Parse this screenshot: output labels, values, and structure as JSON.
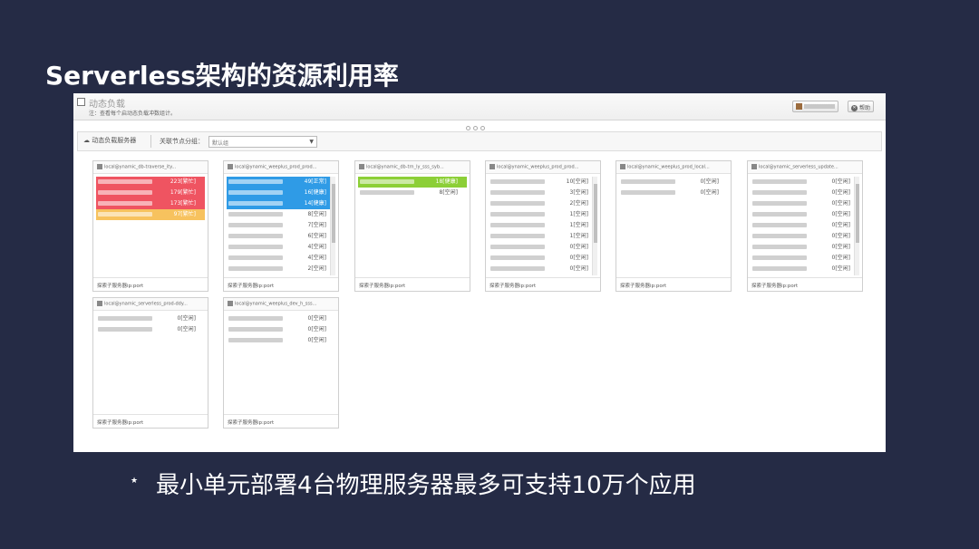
{
  "slide": {
    "title": "Serverless架构的资源利用率",
    "bullet_symbol": "★",
    "bullet_text": "最小单元部署4台物理服务器最多可支持10万个应用"
  },
  "app": {
    "heading": "动态负载",
    "note": "注：查看每个启动态负载冲数组计。",
    "help_label": "帮助",
    "filter_tab": "动态负载服务器",
    "filter_label": "关联节点分组：",
    "filter_value": "默认组"
  },
  "cards": [
    {
      "title": "local@ynamic_db-traverse_ity...",
      "footer": "探索子服务器ip:port",
      "rows": [
        {
          "status": "red",
          "value": "223[繁忙]"
        },
        {
          "status": "red",
          "value": "179[繁忙]"
        },
        {
          "status": "red",
          "value": "173[繁忙]"
        },
        {
          "status": "orange",
          "value": "97[繁忙]"
        }
      ]
    },
    {
      "title": "local@ynamic_weeplus_prod_prod...",
      "footer": "探索子服务器ip:port",
      "scroll": true,
      "rows": [
        {
          "status": "blue",
          "value": "49[正常]"
        },
        {
          "status": "blue",
          "value": "16[健康]"
        },
        {
          "status": "blue",
          "value": "14[健康]"
        },
        {
          "status": "",
          "value": "8[空闲]"
        },
        {
          "status": "",
          "value": "7[空闲]"
        },
        {
          "status": "",
          "value": "6[空闲]"
        },
        {
          "status": "",
          "value": "4[空闲]"
        },
        {
          "status": "",
          "value": "4[空闲]"
        },
        {
          "status": "",
          "value": "2[空闲]"
        }
      ]
    },
    {
      "title": "local@ynamic_db-trn_ly_sss_syb...",
      "footer": "探索子服务器ip:port",
      "rows": [
        {
          "status": "green",
          "value": "18[健康]"
        },
        {
          "status": "",
          "value": "8[空闲]"
        }
      ]
    },
    {
      "title": "local@ynamic_weeplus_prod_prod...",
      "footer": "探索子服务器ip:port",
      "scroll": true,
      "rows": [
        {
          "status": "",
          "value": "10[空闲]"
        },
        {
          "status": "",
          "value": "3[空闲]"
        },
        {
          "status": "",
          "value": "2[空闲]"
        },
        {
          "status": "",
          "value": "1[空闲]"
        },
        {
          "status": "",
          "value": "1[空闲]"
        },
        {
          "status": "",
          "value": "1[空闲]"
        },
        {
          "status": "",
          "value": "0[空闲]"
        },
        {
          "status": "",
          "value": "0[空闲]"
        },
        {
          "status": "",
          "value": "0[空闲]"
        }
      ]
    },
    {
      "title": "local@ynamic_weeplus_prod_local...",
      "footer": "探索子服务器ip:port",
      "rows": [
        {
          "status": "",
          "value": "0[空闲]"
        },
        {
          "status": "",
          "value": "0[空闲]"
        }
      ]
    },
    {
      "title": "local@ynamic_serverless_update...",
      "footer": "探索子服务器ip:port",
      "scroll": true,
      "rows": [
        {
          "status": "",
          "value": "0[空闲]"
        },
        {
          "status": "",
          "value": "0[空闲]"
        },
        {
          "status": "",
          "value": "0[空闲]"
        },
        {
          "status": "",
          "value": "0[空闲]"
        },
        {
          "status": "",
          "value": "0[空闲]"
        },
        {
          "status": "",
          "value": "0[空闲]"
        },
        {
          "status": "",
          "value": "0[空闲]"
        },
        {
          "status": "",
          "value": "0[空闲]"
        },
        {
          "status": "",
          "value": "0[空闲]"
        }
      ]
    },
    {
      "title": "local@ynamic_serverless_prod-ddy...",
      "footer": "探索子服务器ip:port",
      "rows": [
        {
          "status": "",
          "value": "0[空闲]"
        },
        {
          "status": "",
          "value": "0[空闲]"
        }
      ]
    },
    {
      "title": "local@ynamic_weeplus_dev_h_sss...",
      "footer": "探索子服务器ip:port",
      "rows": [
        {
          "status": "",
          "value": "0[空闲]"
        },
        {
          "status": "",
          "value": "0[空闲]"
        },
        {
          "status": "",
          "value": "0[空闲]"
        }
      ]
    }
  ]
}
